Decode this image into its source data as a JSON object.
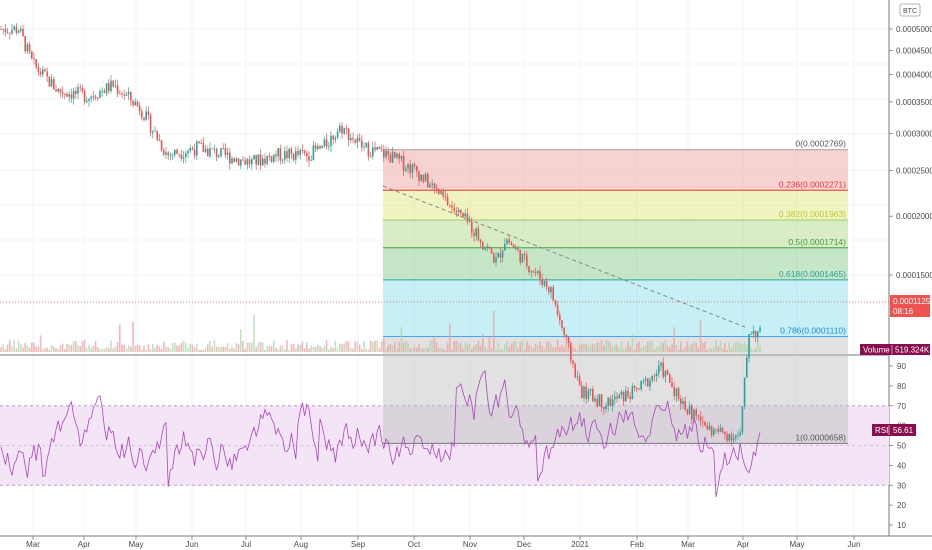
{
  "symbol_badge": "BTC",
  "colors": {
    "up": "#26a69a",
    "down": "#ef5350",
    "rsi_line": "#ab47bc",
    "rsi_band": "#f3e5f5",
    "price_tag": "#ef5350",
    "volume_tag": "#880e4f",
    "rsi_tag": "#880e4f"
  },
  "price_tag": {
    "value": "0.0001125",
    "countdown": "08:16"
  },
  "volume_tag": {
    "label": "Volume",
    "value": "519.324K"
  },
  "rsi_tag": {
    "label": "RSI",
    "value": "56.61"
  },
  "chart_data": [
    {
      "type": "candlestick",
      "scale": "log",
      "x_tick_labels": [
        "Mar",
        "Apr",
        "May",
        "Jun",
        "Jul",
        "Aug",
        "Sep",
        "Oct",
        "Nov",
        "Dec",
        "2021",
        "Feb",
        "Mar",
        "Apr",
        "May",
        "Jun"
      ],
      "y_tick_labels": [
        "0.0005000",
        "0.0004500",
        "0.0004000",
        "0.0003500",
        "0.0003000",
        "0.0002500",
        "0.0002000",
        "0.0001500"
      ],
      "series": [
        {
          "x": [
            "Feb 22",
            "Mar 1",
            "Mar 15",
            "Apr 1",
            "Apr 15",
            "Apr 30",
            "May 15",
            "Jun 1",
            "Jun 15",
            "Jul 1",
            "Jul 15",
            "Aug 1",
            "Aug 10",
            "Aug 20",
            "Sep 1",
            "Sep 15",
            "Oct 1",
            "Oct 15",
            "Nov 1",
            "Nov 15",
            "Nov 20",
            "Dec 1",
            "Dec 15",
            "Jan 1",
            "Jan 15",
            "Feb 1",
            "Feb 15",
            "Mar 1",
            "Mar 15",
            "Mar 31",
            "Apr 5",
            "Apr 11"
          ],
          "close": [
            0.0005,
            0.00042,
            0.00037,
            0.00036,
            0.00038,
            0.00034,
            0.00027,
            0.00028,
            0.00027,
            0.00026,
            0.00027,
            0.00027,
            0.00028,
            0.00031,
            0.00028,
            0.00027,
            0.00025,
            0.00022,
            0.00019,
            0.00016,
            0.00018,
            0.00016,
            0.00014,
            8.5e-05,
            8e-05,
            8.5e-05,
            9.5e-05,
            7.8e-05,
            7e-05,
            6.8e-05,
            0.000115,
            0.0001125
          ]
        }
      ]
    },
    {
      "type": "fibonacci_retracement",
      "levels": [
        {
          "ratio": "0",
          "price": "0.0002769",
          "label": "0(0.0002769)"
        },
        {
          "ratio": "0.236",
          "price": "0.0002271",
          "label": "0.236(0.0002271)"
        },
        {
          "ratio": "0.382",
          "price": "0.0001963",
          "label": "0.382(0.0001963)"
        },
        {
          "ratio": "0.5",
          "price": "0.0001714",
          "label": "0.5(0.0001714)"
        },
        {
          "ratio": "0.618",
          "price": "0.0001465",
          "label": "0.618(0.0001465)"
        },
        {
          "ratio": "0.786",
          "price": "0.0001110",
          "label": "0.786(0.0001110)"
        },
        {
          "ratio": "1",
          "price": "0.0000658",
          "label": "1(0.0000658)"
        }
      ]
    },
    {
      "type": "line",
      "indicator": "RSI",
      "y_tick_labels": [
        "90",
        "80",
        "70",
        "60",
        "50",
        "40",
        "30",
        "20",
        "10"
      ],
      "ylim": [
        8,
        92
      ],
      "bands": [
        30,
        70
      ],
      "last_value": 56.61
    }
  ]
}
